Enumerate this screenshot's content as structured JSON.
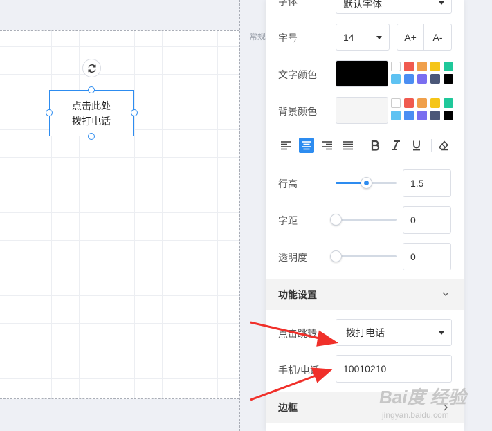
{
  "canvas": {
    "widget_line1": "点击此处",
    "widget_line2": "拨打电话",
    "side_label": "常规"
  },
  "panel": {
    "font_family": {
      "label": "字体",
      "value": "默认字体"
    },
    "font_size": {
      "label": "字号",
      "value": "14",
      "increase": "A+",
      "decrease": "A-"
    },
    "text_color": {
      "label": "文字颜色",
      "value": "#000000"
    },
    "bg_color": {
      "label": "背景颜色",
      "value": "#f5f5f5"
    },
    "swatches": [
      "#ffffff",
      "#f05a4f",
      "#f0a04b",
      "#f5c518",
      "#1fc89a",
      "#5ec2f2",
      "#4b8ef2",
      "#7a6ef0",
      "#4b5778",
      "#000000"
    ],
    "line_height": {
      "label": "行高",
      "value": "1.5",
      "fraction": 0.5
    },
    "letter_spacing": {
      "label": "字距",
      "value": "0",
      "fraction": 0
    },
    "opacity": {
      "label": "透明度",
      "value": "0",
      "fraction": 0
    },
    "function_section": {
      "title": "功能设置"
    },
    "click_action": {
      "label": "点击跳转",
      "value": "拨打电话"
    },
    "phone": {
      "label": "手机/电话",
      "value": "10010210"
    },
    "border_section": {
      "title": "边框"
    }
  },
  "watermark": {
    "main": "Bai度 经验",
    "sub": "jingyan.baidu.com"
  },
  "colors": {
    "accent": "#2d8cf0",
    "arrow": "#f0302a"
  }
}
